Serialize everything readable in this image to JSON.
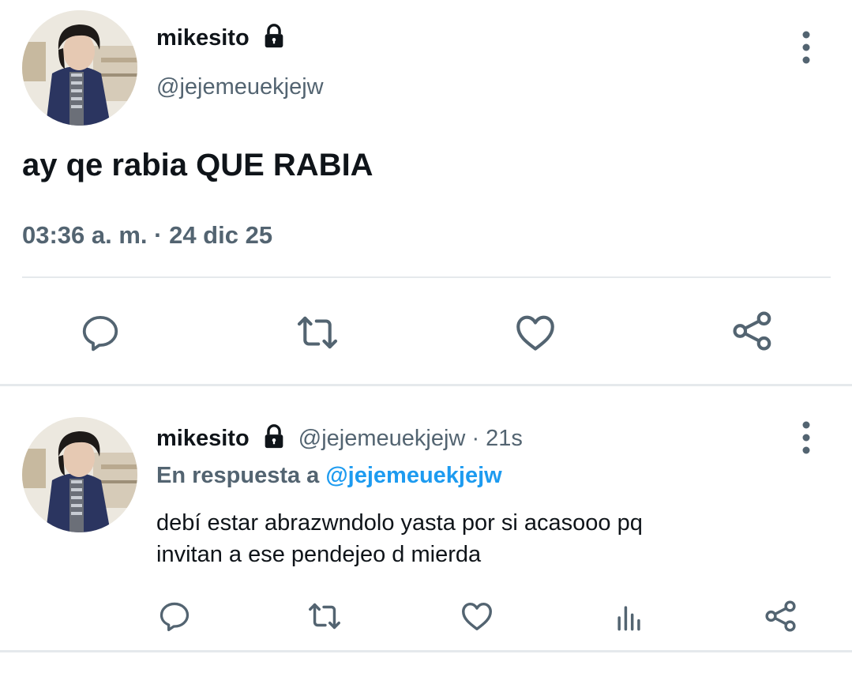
{
  "main_tweet": {
    "display_name": "mikesito",
    "handle": "@jejemeuekjejw",
    "text": "ay qe rabia QUE RABIA",
    "timestamp": "03:36 a. m. · 24 dic 25",
    "locked": true
  },
  "reply_tweet": {
    "display_name": "mikesito",
    "handle": "@jejemeuekjejw",
    "time_ago": "21s",
    "reply_prefix": "En respuesta a",
    "reply_to": "@jejemeuekjejw",
    "text_line1": "debí estar abrazwndolo yasta por si acasooo pq",
    "text_line2": "invitan a ese pendejeo d mierda",
    "locked": true
  },
  "colors": {
    "text": "#0f1419",
    "secondary": "#536471",
    "icon": "#536471",
    "accent": "#1d9bf0",
    "divider": "#e5e9ec"
  },
  "icons": {
    "main_actions": [
      "reply-icon",
      "retweet-icon",
      "like-icon",
      "share-icon"
    ],
    "reply_actions": [
      "reply-icon",
      "retweet-icon",
      "like-icon",
      "analytics-icon",
      "share-icon"
    ]
  }
}
